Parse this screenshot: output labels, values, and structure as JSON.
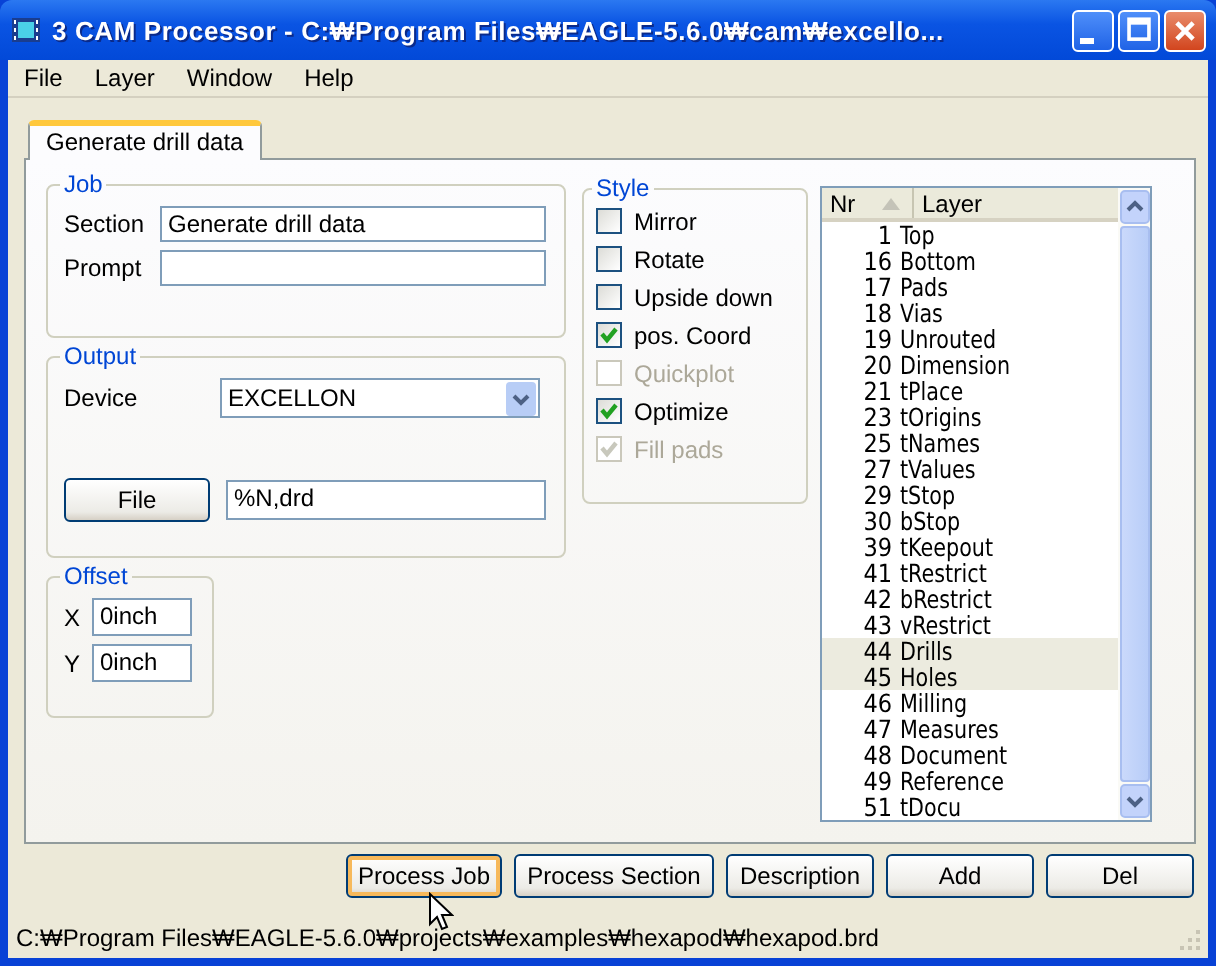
{
  "window": {
    "title": "3 CAM Processor - C:₩Program Files₩EAGLE-5.6.0₩cam₩excello..."
  },
  "menu": [
    "File",
    "Layer",
    "Window",
    "Help"
  ],
  "tabs": [
    {
      "label": "Generate drill data",
      "selected": true
    }
  ],
  "job": {
    "title": "Job",
    "fields": [
      {
        "label": "Section",
        "value": "Generate drill data"
      },
      {
        "label": "Prompt"
      }
    ]
  },
  "output": {
    "title": "Output",
    "device_label": "Device",
    "device": "EXCELLON",
    "file_button": "File",
    "file": "%N,drd"
  },
  "offset": {
    "title": "Offset",
    "fields": [
      {
        "label": "X",
        "value": "0inch"
      },
      {
        "label": "Y",
        "value": "0inch"
      }
    ]
  },
  "style": {
    "title": "Style",
    "options": [
      {
        "label": "Mirror",
        "checked": false,
        "disabled": false
      },
      {
        "label": "Rotate",
        "checked": false,
        "disabled": false
      },
      {
        "label": "Upside down",
        "checked": false,
        "disabled": false
      },
      {
        "label": "pos. Coord",
        "checked": true,
        "disabled": false
      },
      {
        "label": "Quickplot",
        "checked": false,
        "disabled": true
      },
      {
        "label": "Optimize",
        "checked": true,
        "disabled": false
      },
      {
        "label": "Fill pads",
        "checked": true,
        "disabled": true
      }
    ]
  },
  "layers": {
    "columns": [
      "Nr",
      "Layer"
    ],
    "rows": [
      {
        "nr": "1",
        "name": "Top",
        "selected": false
      },
      {
        "nr": "16",
        "name": "Bottom",
        "selected": false
      },
      {
        "nr": "17",
        "name": "Pads",
        "selected": false
      },
      {
        "nr": "18",
        "name": "Vias",
        "selected": false
      },
      {
        "nr": "19",
        "name": "Unrouted",
        "selected": false
      },
      {
        "nr": "20",
        "name": "Dimension",
        "selected": false
      },
      {
        "nr": "21",
        "name": "tPlace",
        "selected": false
      },
      {
        "nr": "23",
        "name": "tOrigins",
        "selected": false
      },
      {
        "nr": "25",
        "name": "tNames",
        "selected": false
      },
      {
        "nr": "27",
        "name": "tValues",
        "selected": false
      },
      {
        "nr": "29",
        "name": "tStop",
        "selected": false
      },
      {
        "nr": "30",
        "name": "bStop",
        "selected": false
      },
      {
        "nr": "39",
        "name": "tKeepout",
        "selected": false
      },
      {
        "nr": "41",
        "name": "tRestrict",
        "selected": false
      },
      {
        "nr": "42",
        "name": "bRestrict",
        "selected": false
      },
      {
        "nr": "43",
        "name": "vRestrict",
        "selected": false
      },
      {
        "nr": "44",
        "name": "Drills",
        "selected": true
      },
      {
        "nr": "45",
        "name": "Holes",
        "selected": true
      },
      {
        "nr": "46",
        "name": "Milling",
        "selected": false
      },
      {
        "nr": "47",
        "name": "Measures",
        "selected": false
      },
      {
        "nr": "48",
        "name": "Document",
        "selected": false
      },
      {
        "nr": "49",
        "name": "Reference",
        "selected": false
      },
      {
        "nr": "51",
        "name": "tDocu",
        "selected": false
      }
    ]
  },
  "buttons": [
    {
      "label": "Process Job",
      "focused": true
    },
    {
      "label": "Process Section",
      "focused": false
    },
    {
      "label": "Description",
      "focused": false
    },
    {
      "label": "Add",
      "focused": false
    },
    {
      "label": "Del",
      "focused": false
    }
  ],
  "status_bar": "C:₩Program Files₩EAGLE-5.6.0₩projects₩examples₩hexapod₩hexapod.brd"
}
